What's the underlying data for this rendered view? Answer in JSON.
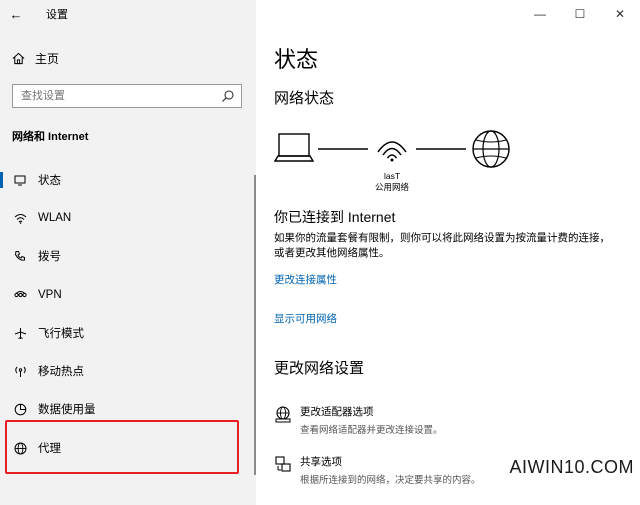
{
  "window": {
    "title": "设置",
    "back_glyph": "←",
    "minimize_glyph": "—",
    "maximize_glyph": "☐",
    "close_glyph": "✕"
  },
  "sidebar": {
    "home_label": "主页",
    "search_placeholder": "查找设置",
    "section_label": "网络和 Internet",
    "items": [
      {
        "label": "状态",
        "icon": "status-icon",
        "selected": true
      },
      {
        "label": "WLAN",
        "icon": "wifi-icon"
      },
      {
        "label": "拨号",
        "icon": "dialup-icon"
      },
      {
        "label": "VPN",
        "icon": "vpn-icon"
      },
      {
        "label": "飞行模式",
        "icon": "airplane-icon"
      },
      {
        "label": "移动热点",
        "icon": "hotspot-icon"
      },
      {
        "label": "数据使用量",
        "icon": "data-usage-icon"
      },
      {
        "label": "代理",
        "icon": "globe-icon"
      }
    ]
  },
  "main": {
    "page_title": "状态",
    "network_status_title": "网络状态",
    "network_name": "lasT",
    "network_type": "公用网络",
    "connected_title": "你已连接到 Internet",
    "connected_desc": "如果你的流量套餐有限制，则你可以将此网络设置为按流量计费的连接，或者更改其他网络属性。",
    "link_change_props": "更改连接属性",
    "link_show_networks": "显示可用网络",
    "change_settings_title": "更改网络设置",
    "options": [
      {
        "title": "更改适配器选项",
        "desc": "查看网络适配器并更改连接设置。",
        "icon": "adapter-icon"
      },
      {
        "title": "共享选项",
        "desc": "根据所连接到的网络，决定要共享的内容。",
        "icon": "sharing-icon"
      }
    ]
  },
  "watermark": "AIWIN10.COM",
  "colors": {
    "sidebar_bg": "#f2f2f2",
    "accent": "#0063b1",
    "highlight": "#e81e25"
  }
}
